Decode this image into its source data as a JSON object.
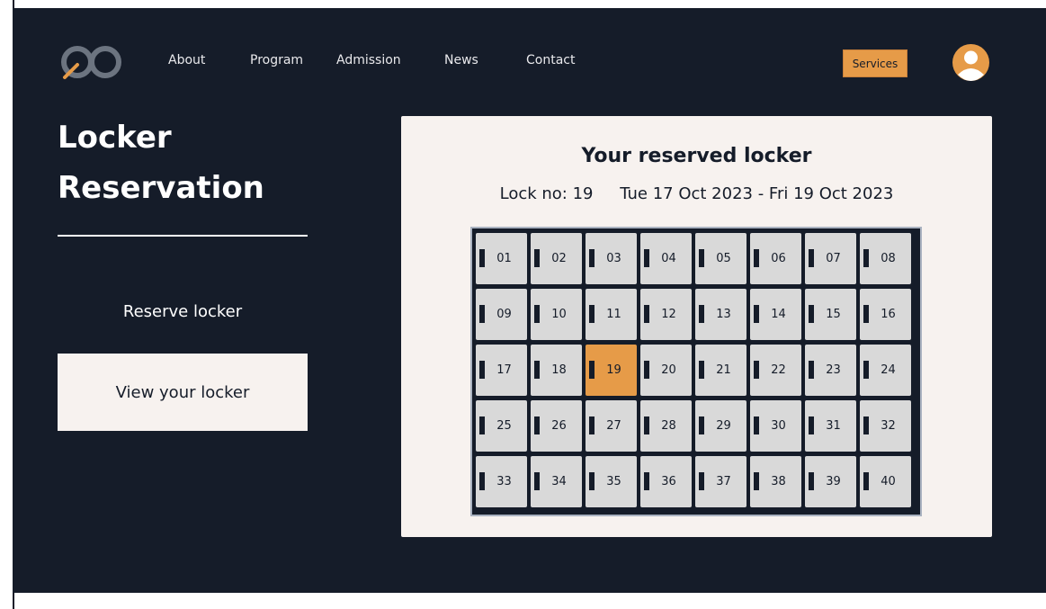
{
  "nav": {
    "items": [
      "About",
      "Program",
      "Admission",
      "News",
      "Contact"
    ],
    "services_label": "Services"
  },
  "hero": {
    "title_line1": "Locker",
    "title_line2": "Reservation",
    "reserve_label": "Reserve locker",
    "view_label": "View your locker"
  },
  "panel": {
    "title": "Your reserved locker",
    "lock_no": "Lock no: 19",
    "dates": "Tue 17 Oct 2023 - Fri 19 Oct 2023"
  },
  "lockers": {
    "numbers": [
      "01",
      "02",
      "03",
      "04",
      "05",
      "06",
      "07",
      "08",
      "09",
      "10",
      "11",
      "12",
      "13",
      "14",
      "15",
      "16",
      "17",
      "18",
      "19",
      "20",
      "21",
      "22",
      "23",
      "24",
      "25",
      "26",
      "27",
      "28",
      "29",
      "30",
      "31",
      "32",
      "33",
      "34",
      "35",
      "36",
      "37",
      "38",
      "39",
      "40"
    ],
    "reserved": "19"
  },
  "colors": {
    "background": "#151c29",
    "accent": "#e69b48",
    "panel": "#f7f2ef",
    "locker": "#d9d9d9"
  },
  "icons": {
    "logo": "infinity-logo-icon",
    "avatar": "user-avatar-icon"
  }
}
